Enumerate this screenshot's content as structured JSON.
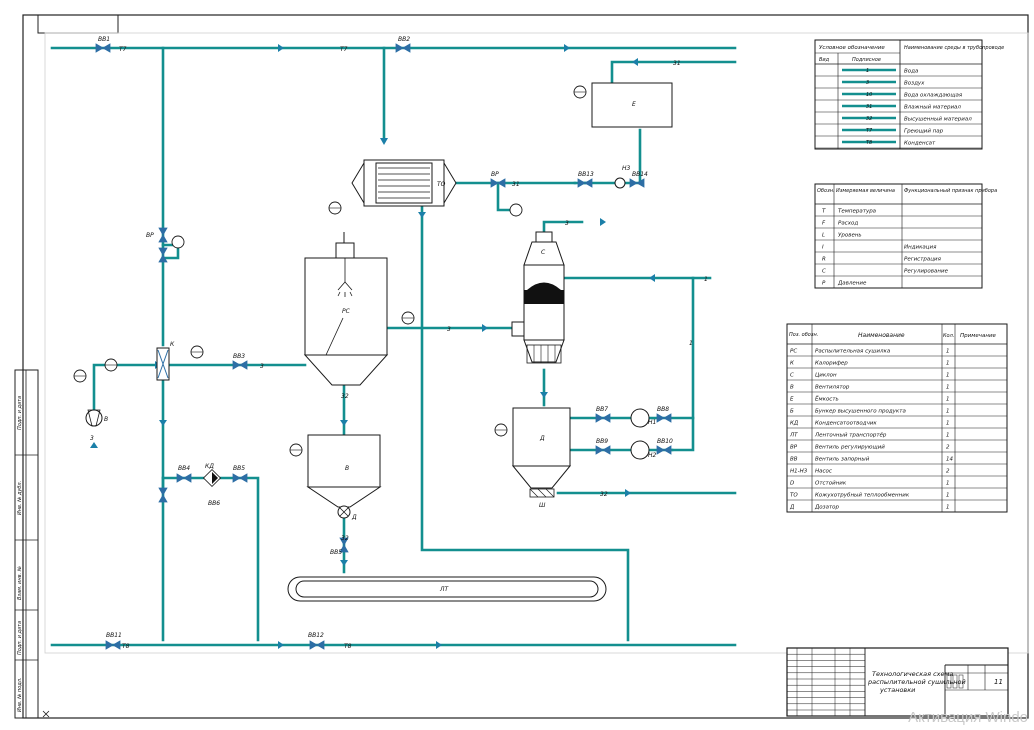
{
  "title_block": {
    "title": "Технологическая схема распылительной сушильной установки",
    "sheet_no": "11"
  },
  "watermark": "Активация Windo",
  "pipe_labels": {
    "t7": "Т7",
    "t8": "Т8",
    "l31": "31",
    "l3": "3",
    "l32": "32",
    "l1": "1"
  },
  "valves": {
    "vv1": "ВВ1",
    "vv2": "ВВ2",
    "vr": "ВР",
    "vv13": "ВВ13",
    "vv14": "ВВ14",
    "vp": "ВР",
    "vv3": "ВВ3",
    "vv4": "ВВ4",
    "vv5": "ВВ5",
    "vv6": "ВВ6",
    "vv7": "ВВ7",
    "vv8": "ВВ8",
    "vv9": "ВВ9",
    "vv10": "ВВ10",
    "vv11": "ВВ11",
    "vv12": "ВВ12",
    "vv15": "ВВ5"
  },
  "equipment": {
    "e": "Е",
    "to": "ТО",
    "rs": "РС",
    "c": "С",
    "v": "В",
    "d": "Д",
    "lt": "ЛТ",
    "k": "К",
    "h3": "Н3",
    "h1": "Н1",
    "h2": "Н2",
    "b": "В",
    "kd": "КД",
    "sh": "Ш",
    "d2": "Д"
  },
  "legend": {
    "header_left": "Условное обозначение",
    "header_right": "Наименование среды в трубопроводе",
    "sub_a": "Вид",
    "sub_b": "Подписное",
    "rows": [
      {
        "code": "1",
        "name": "Вода"
      },
      {
        "code": "3",
        "name": "Воздух"
      },
      {
        "code": "10",
        "name": "Вода охлаждающая"
      },
      {
        "code": "31",
        "name": "Влажный материал"
      },
      {
        "code": "32",
        "name": "Высушенный материал"
      },
      {
        "code": "Т7",
        "name": "Греющий пар"
      },
      {
        "code": "Т8",
        "name": "Конденсат"
      }
    ]
  },
  "instruments": {
    "headers": [
      "Обозн.",
      "Измеряемая величина",
      "Функциональный признак прибора"
    ],
    "rows": [
      {
        "code": "T",
        "measure": "Температура",
        "func": ""
      },
      {
        "code": "F",
        "measure": "Расход",
        "func": ""
      },
      {
        "code": "L",
        "measure": "Уровень",
        "func": ""
      },
      {
        "code": "I",
        "measure": "",
        "func": "Индикация"
      },
      {
        "code": "R",
        "measure": "",
        "func": "Регистрация"
      },
      {
        "code": "C",
        "measure": "",
        "func": "Регулирование"
      },
      {
        "code": "P",
        "measure": "Давление",
        "func": ""
      }
    ]
  },
  "spec": {
    "headers": [
      "Поз. обозн.",
      "Наименование",
      "Кол.",
      "Примечание"
    ],
    "rows": [
      {
        "pos": "РС",
        "name": "Распылительная сушилка",
        "qty": "1"
      },
      {
        "pos": "К",
        "name": "Калорифер",
        "qty": "1"
      },
      {
        "pos": "С",
        "name": "Циклон",
        "qty": "1"
      },
      {
        "pos": "В",
        "name": "Вентилятор",
        "qty": "1"
      },
      {
        "pos": "Е",
        "name": "Ёмкость",
        "qty": "1"
      },
      {
        "pos": "Б",
        "name": "Бункер высушенного продукта",
        "qty": "1"
      },
      {
        "pos": "КД",
        "name": "Конденсатоотводчик",
        "qty": "1"
      },
      {
        "pos": "ЛТ",
        "name": "Ленточный транспортёр",
        "qty": "1"
      },
      {
        "pos": "ВР",
        "name": "Вентиль регулирующий",
        "qty": "2"
      },
      {
        "pos": "ВВ",
        "name": "Вентиль запорный",
        "qty": "14"
      },
      {
        "pos": "Н1-Н3",
        "name": "Насос",
        "qty": "2"
      },
      {
        "pos": "D",
        "name": "Отстойник",
        "qty": "1"
      },
      {
        "pos": "ТО",
        "name": "Кожухотрубный теплообменник",
        "qty": "1"
      },
      {
        "pos": "Д",
        "name": "Дозатор",
        "qty": "1"
      }
    ]
  },
  "frame_side_labels": [
    "Подп. и дата",
    "Инв. № дубл.",
    "Взам. инв. №",
    "Подп. и дата",
    "Инв. № подл."
  ],
  "colors": {
    "pipe": "#138f8f",
    "ink": "#1a1a1a",
    "accent": "#2d6ea5"
  }
}
